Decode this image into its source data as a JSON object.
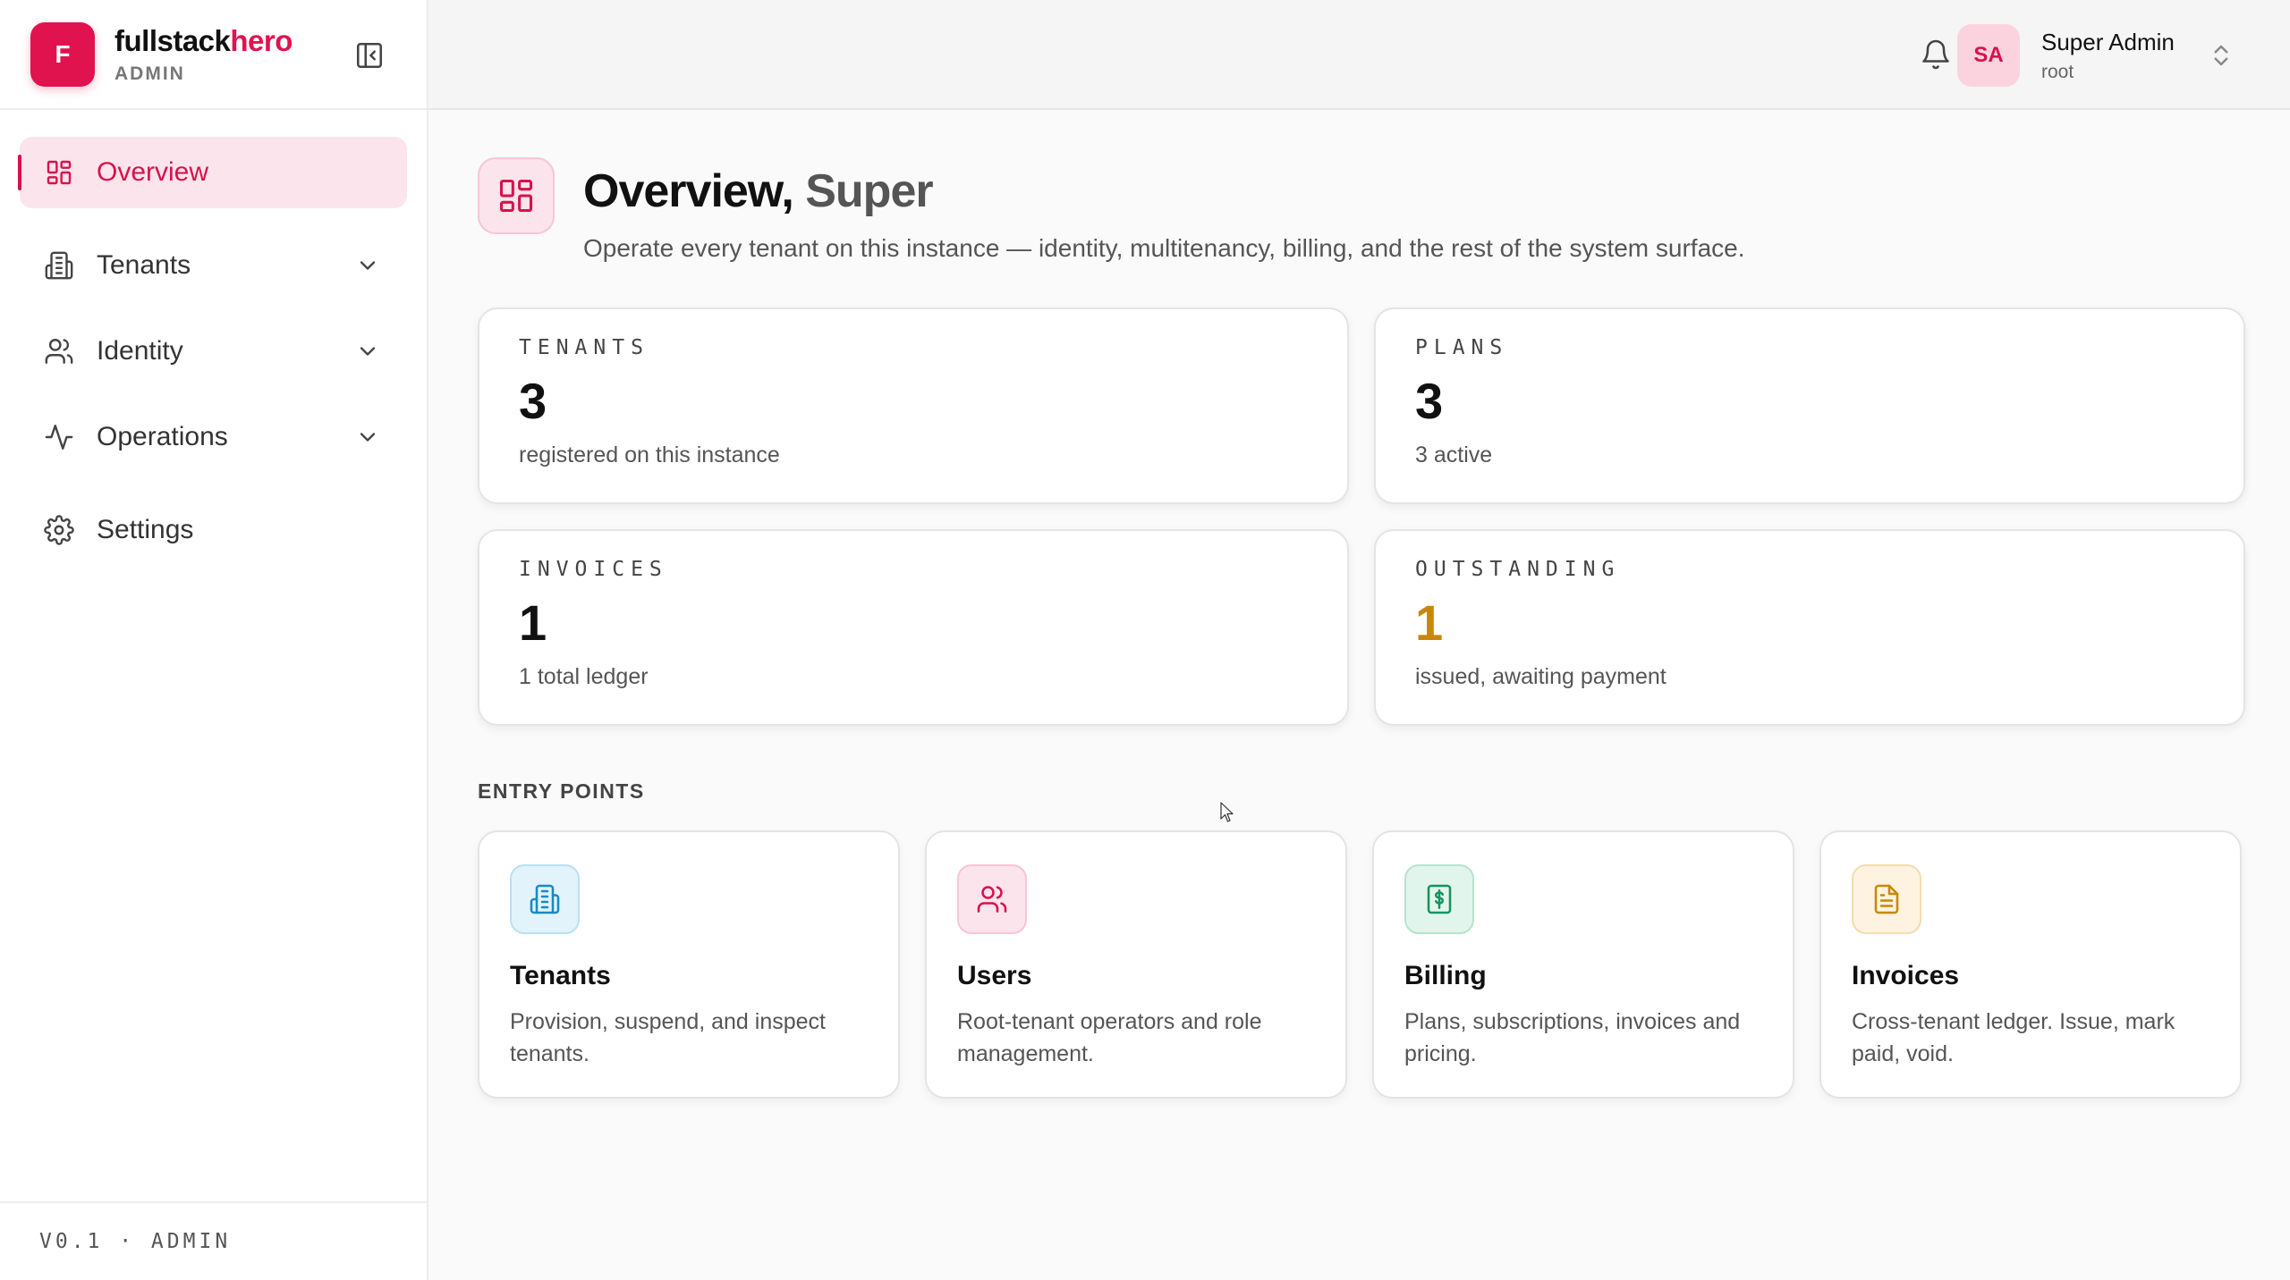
{
  "brand": {
    "logo_letter": "F",
    "name_primary": "fullstack",
    "name_accent": "hero",
    "subtitle": "ADMIN"
  },
  "sidebar": {
    "items": [
      {
        "label": "Overview",
        "icon": "layout-grid-icon",
        "active": true
      },
      {
        "label": "Tenants",
        "icon": "building-icon",
        "expandable": true
      },
      {
        "label": "Identity",
        "icon": "users-icon",
        "expandable": true
      },
      {
        "label": "Operations",
        "icon": "activity-icon",
        "expandable": true
      },
      {
        "label": "Settings",
        "icon": "gear-icon"
      }
    ],
    "footer": "V0.1 · ADMIN"
  },
  "header": {
    "user": {
      "initials": "SA",
      "name": "Super Admin",
      "role": "root"
    }
  },
  "page": {
    "title": "Overview,",
    "title_name": "Super",
    "subtitle": "Operate every tenant on this instance — identity, multitenancy, billing, and the rest of the system surface."
  },
  "stats": [
    {
      "label": "TENANTS",
      "value": "3",
      "desc": "registered on this instance"
    },
    {
      "label": "PLANS",
      "value": "3",
      "desc": "3 active"
    },
    {
      "label": "INVOICES",
      "value": "1",
      "desc": "1 total ledger"
    },
    {
      "label": "OUTSTANDING",
      "value": "1",
      "desc": "issued, awaiting payment"
    }
  ],
  "entry_points": {
    "label": "ENTRY POINTS",
    "items": [
      {
        "title": "Tenants",
        "desc": "Provision, suspend, and inspect tenants.",
        "icon": "building-icon",
        "color": "#1a8ac4",
        "bg": "#e3f3fb"
      },
      {
        "title": "Users",
        "desc": "Root-tenant operators and role management.",
        "icon": "users-icon",
        "color": "#d6124c",
        "bg": "#fce4ec"
      },
      {
        "title": "Billing",
        "desc": "Plans, subscriptions, invoices and pricing.",
        "icon": "dollar-receipt-icon",
        "color": "#149460",
        "bg": "#e2f5ec"
      },
      {
        "title": "Invoices",
        "desc": "Cross-tenant ledger. Issue, mark paid, void.",
        "icon": "document-icon",
        "color": "#c8870a",
        "bg": "#fdf3e0"
      }
    ]
  },
  "colors": {
    "accent": "#e0134f",
    "warning": "#c8870a"
  }
}
